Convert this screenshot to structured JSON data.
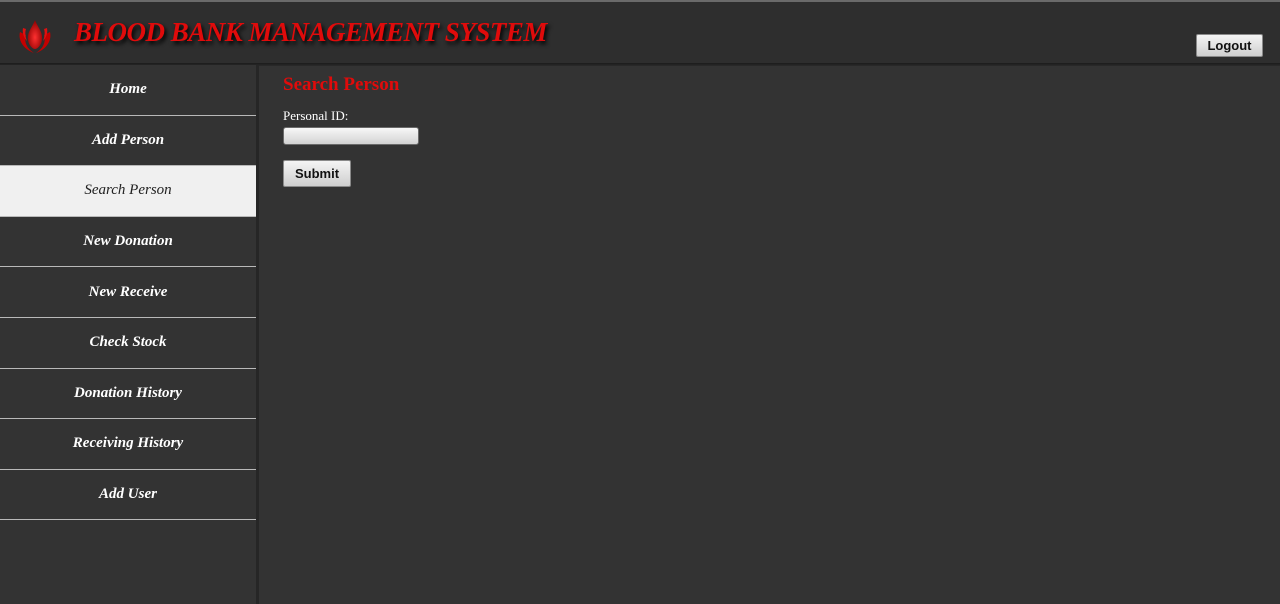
{
  "header": {
    "title": "BLOOD BANK MANAGEMENT SYSTEM",
    "logo_icon": "blood-drop-flame-icon",
    "logout_label": "Logout",
    "accent_color": "#e00b0b"
  },
  "sidebar": {
    "items": [
      {
        "label": "Home",
        "active": false
      },
      {
        "label": "Add Person",
        "active": false
      },
      {
        "label": "Search Person",
        "active": true
      },
      {
        "label": "New Donation",
        "active": false
      },
      {
        "label": "New Receive",
        "active": false
      },
      {
        "label": "Check Stock",
        "active": false
      },
      {
        "label": "Donation History",
        "active": false
      },
      {
        "label": "Receiving History",
        "active": false
      },
      {
        "label": "Add User",
        "active": false
      }
    ]
  },
  "main": {
    "title": "Search Person",
    "personal_id_label": "Personal ID:",
    "personal_id_value": "",
    "submit_label": "Submit"
  }
}
